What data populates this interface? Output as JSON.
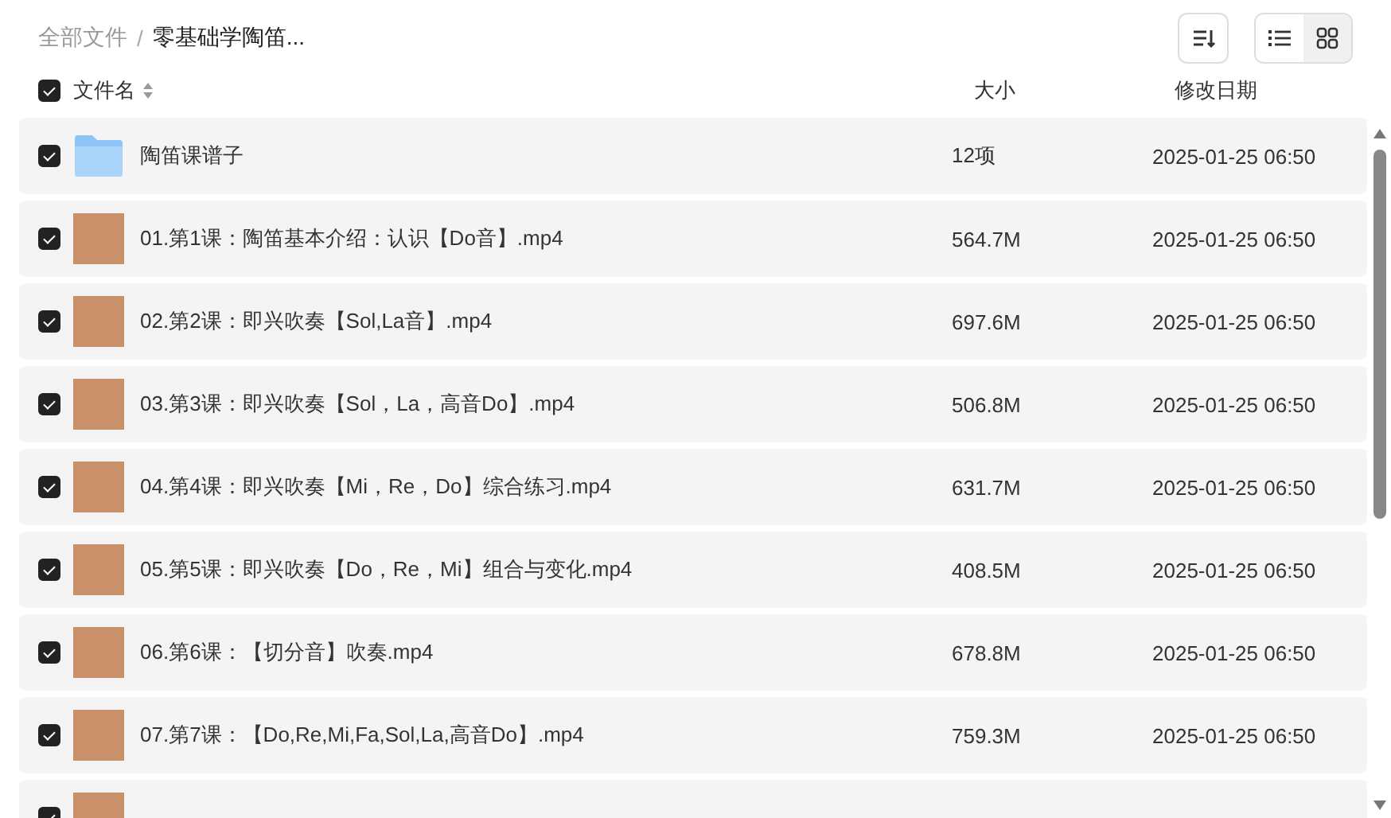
{
  "breadcrumb": [
    {
      "label": "全部文件",
      "current": false
    },
    {
      "separator": "/"
    },
    {
      "label": "零基础学陶笛...",
      "current": true
    }
  ],
  "toolbar": {
    "view_modes": [
      {
        "kind": "list",
        "selected": false
      },
      {
        "kind": "grid",
        "selected": true
      }
    ]
  },
  "table": {
    "select_all": {
      "checked": true
    },
    "columns": [
      "文件名",
      "大小",
      "修改日期"
    ],
    "rows": [
      {
        "kind": "folder",
        "checked": true,
        "name": "陶笛课谱子",
        "size": "12项",
        "modified": "2025-01-25 06:50"
      },
      {
        "kind": "video",
        "checked": true,
        "name": "01.第1课：陶笛基本介绍：认识【Do音】.mp4",
        "size": "564.7M",
        "modified": "2025-01-25 06:50"
      },
      {
        "kind": "video",
        "checked": true,
        "name": "02.第2课：即兴吹奏【Sol,La音】.mp4",
        "size": "697.6M",
        "modified": "2025-01-25 06:50"
      },
      {
        "kind": "video",
        "checked": true,
        "name": "03.第3课：即兴吹奏【Sol，La，高音Do】.mp4",
        "size": "506.8M",
        "modified": "2025-01-25 06:50"
      },
      {
        "kind": "video",
        "checked": true,
        "name": "04.第4课：即兴吹奏【Mi，Re，Do】综合练习.mp4",
        "size": "631.7M",
        "modified": "2025-01-25 06:50"
      },
      {
        "kind": "video",
        "checked": true,
        "name": "05.第5课：即兴吹奏【Do，Re，Mi】组合与变化.mp4",
        "size": "408.5M",
        "modified": "2025-01-25 06:50"
      },
      {
        "kind": "video",
        "checked": true,
        "name": "06.第6课：【切分音】吹奏.mp4",
        "size": "678.8M",
        "modified": "2025-01-25 06:50"
      },
      {
        "kind": "video",
        "checked": true,
        "name": "07.第7课：【Do,Re,Mi,Fa,Sol,La,高音Do】.mp4",
        "size": "759.3M",
        "modified": "2025-01-25 06:50"
      },
      {
        "kind": "video",
        "checked": true
      }
    ]
  }
}
